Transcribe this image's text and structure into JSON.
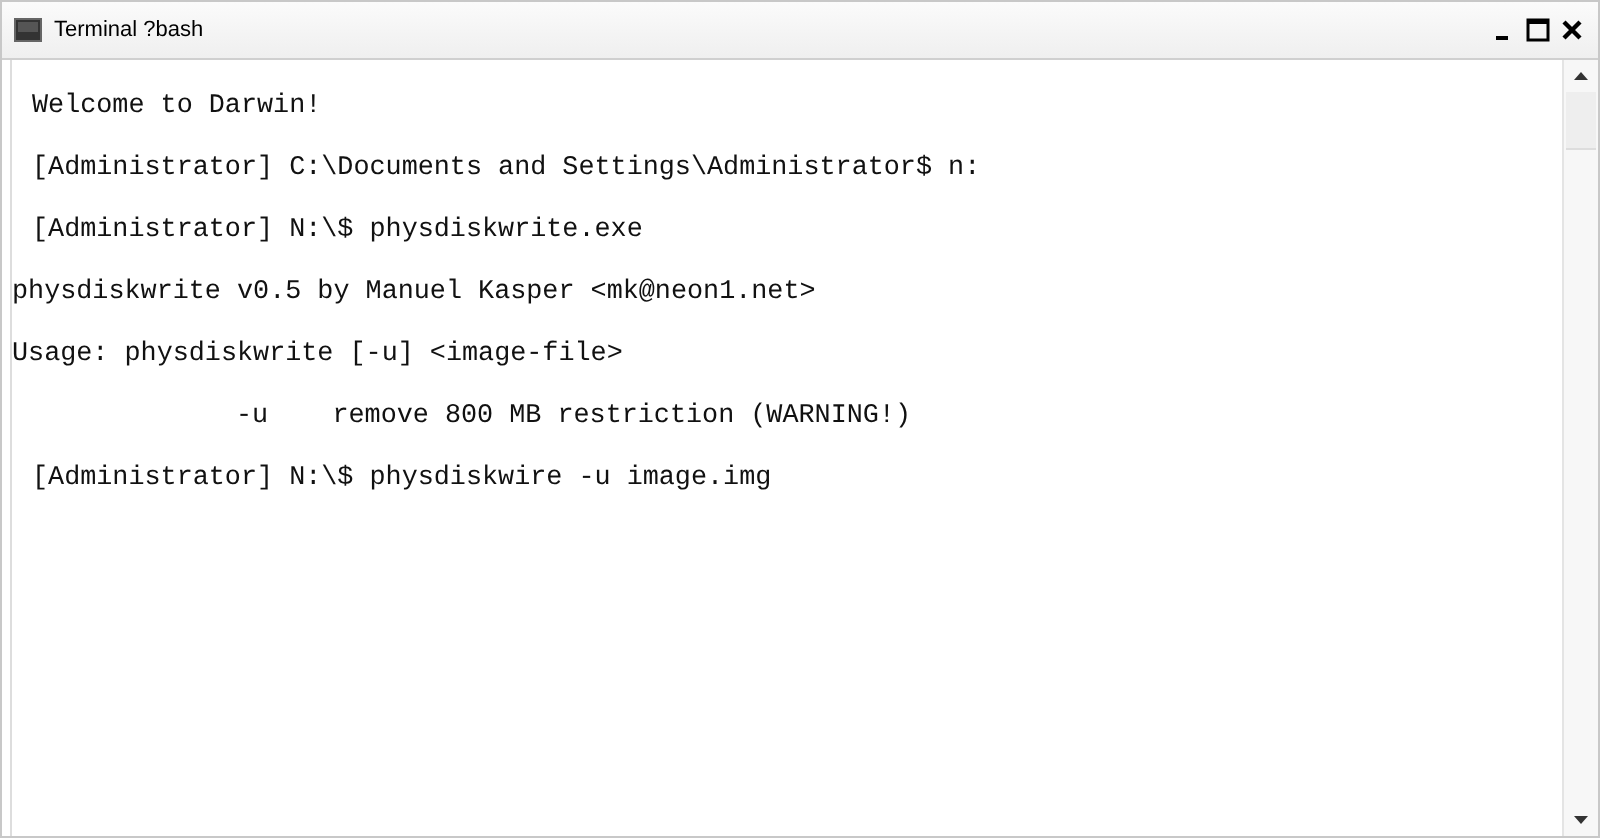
{
  "window": {
    "title": "Terminal ?bash"
  },
  "lines": [
    {
      "kind": "prompt",
      "text": "Welcome to Darwin!"
    },
    {
      "kind": "prompt",
      "text": "[Administrator] C:\\Documents and Settings\\Administrator$ n:"
    },
    {
      "kind": "prompt",
      "text": "[Administrator] N:\\$ physdiskwrite.exe"
    },
    {
      "kind": "output",
      "text": "physdiskwrite v0.5 by Manuel Kasper <mk@neon1.net>"
    },
    {
      "kind": "output",
      "text": "Usage: physdiskwrite [-u] <image-file>"
    },
    {
      "kind": "option",
      "text": "-u    remove 800 MB restriction (WARNING!)"
    },
    {
      "kind": "prompt",
      "text": "[Administrator] N:\\$ physdiskwire -u image.img"
    }
  ]
}
